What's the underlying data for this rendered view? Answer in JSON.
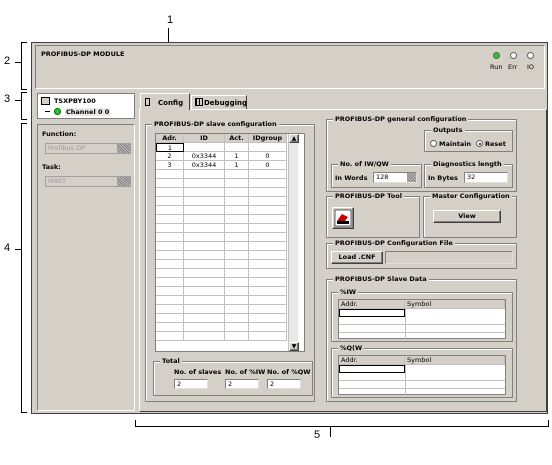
{
  "callouts": {
    "c1": "1",
    "c2": "2",
    "c3": "3",
    "c4": "4",
    "c5": "5"
  },
  "module": {
    "title": "PROFIBUS-DP MODULE",
    "leds": [
      {
        "label": "Run",
        "color": "#22cc22"
      },
      {
        "label": "Err",
        "color": "#ffffff"
      },
      {
        "label": "IO",
        "color": "#ffffff"
      }
    ]
  },
  "tree": {
    "device": "TSXPBY100",
    "channel": "Channel 0 0"
  },
  "left_panel": {
    "function_label": "Function:",
    "function_value": "Profibus DP",
    "task_label": "Task:",
    "task_value": "MAST"
  },
  "tabs": [
    {
      "label": "Config",
      "active": true
    },
    {
      "label": "Debugging",
      "active": false
    }
  ],
  "slave_config": {
    "title": "PROFIBUS-DP slave configuration",
    "columns": [
      "Adr.",
      "ID",
      "Act.",
      "IDgroup"
    ],
    "rows": [
      [
        "1",
        "",
        "",
        ""
      ],
      [
        "2",
        "0x3344",
        "1",
        "0"
      ],
      [
        "3",
        "0x3344",
        "1",
        "0"
      ]
    ]
  },
  "total": {
    "title": "Total",
    "slaves_label": "No. of slaves",
    "slaves_value": "2",
    "iw_label": "No. of %IW",
    "iw_value": "2",
    "qw_label": "No. of %QW",
    "qw_value": "2"
  },
  "general": {
    "title": "PROFIBUS-DP general configuration",
    "outputs_title": "Outputs",
    "maintain": "Maintain",
    "reset": "Reset",
    "selected_output": "Reset",
    "nb_title": "No. of IW/QW",
    "in_words": "In Words",
    "nb_value": "128",
    "diag_title": "Diagnostics length",
    "in_bytes": "In Bytes",
    "diag_value": "32"
  },
  "tool": {
    "title": "PROFIBUS-DP Tool"
  },
  "master": {
    "title": "Master Configuration",
    "view_label": "View"
  },
  "file": {
    "title": "PROFIBUS-DP Configuration File",
    "load_label": "Load .CNF",
    "path": ""
  },
  "slave_data": {
    "title": "PROFIBUS-DP Slave Data",
    "iw_title": "%IW",
    "qw_title": "%Q(W",
    "col_addr": "Addr.",
    "col_symbol": "Symbol"
  }
}
